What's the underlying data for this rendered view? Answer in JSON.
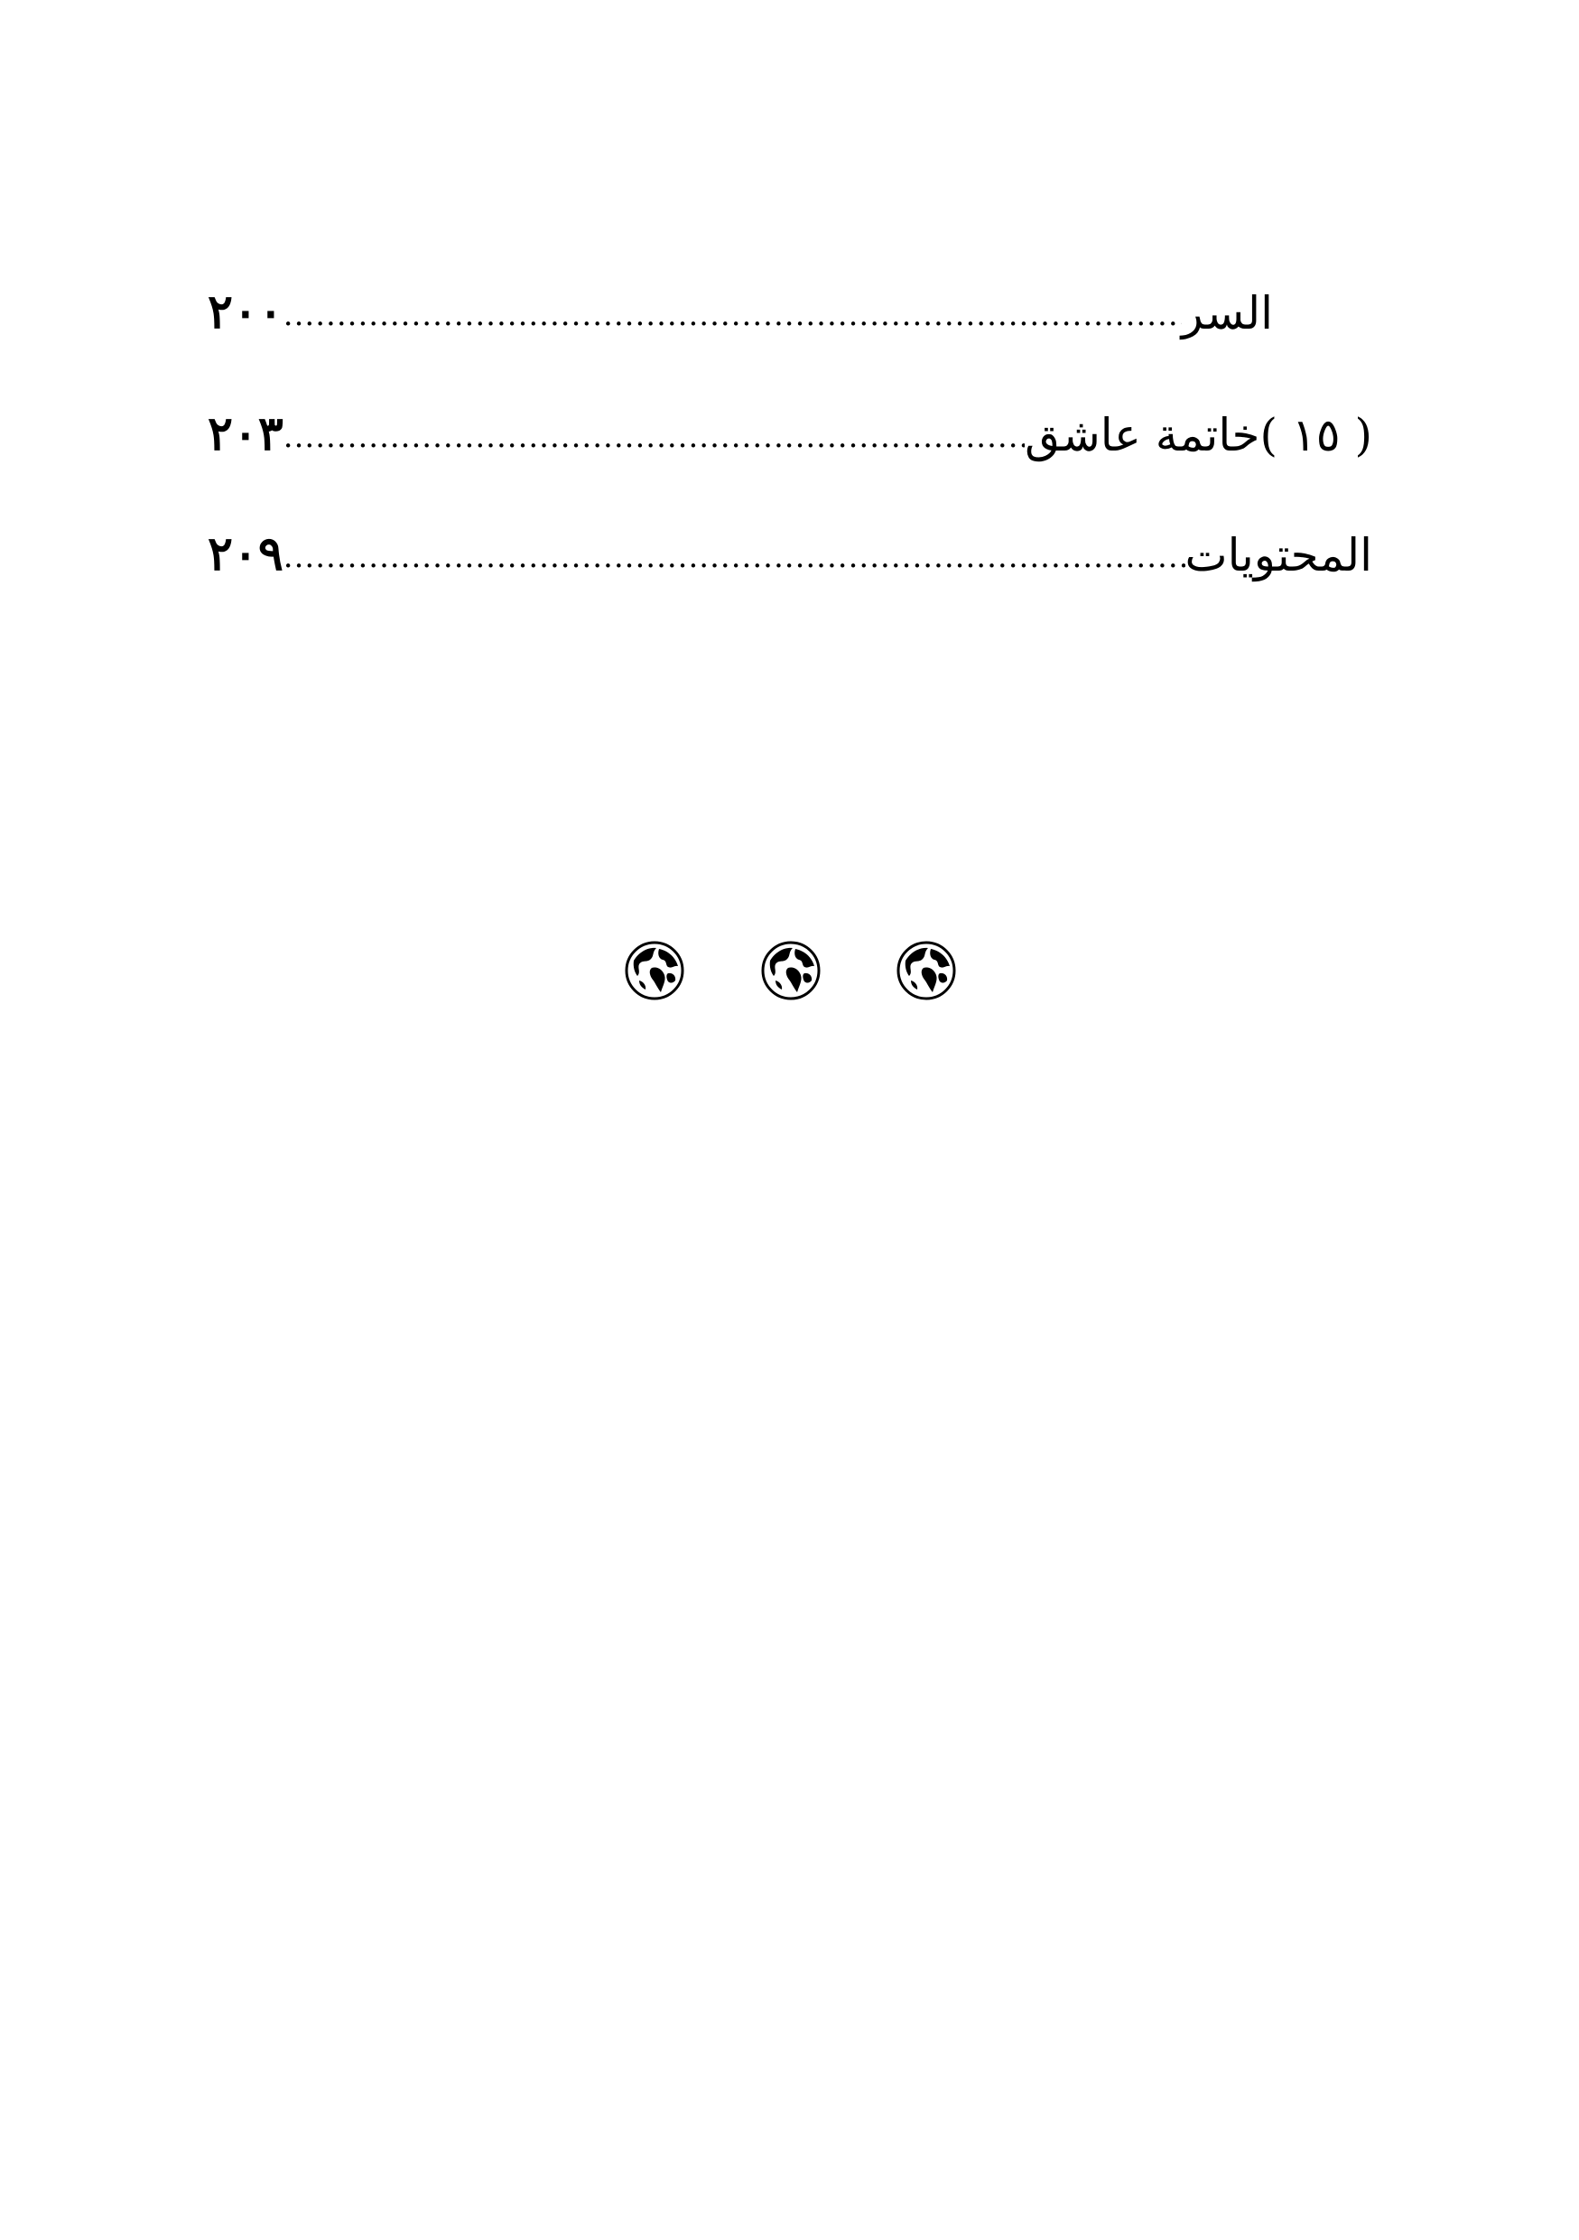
{
  "toc": {
    "entries": [
      {
        "title": "السر",
        "page": "٢٠٠"
      },
      {
        "title": "( ١٥ )خاتمة عاشق",
        "page": "٢٠٣"
      },
      {
        "title": "المحتويات",
        "page": "٢٠٩"
      }
    ]
  },
  "ornaments": {
    "icon": "globe-icon",
    "count": 3,
    "color": "#000000"
  }
}
